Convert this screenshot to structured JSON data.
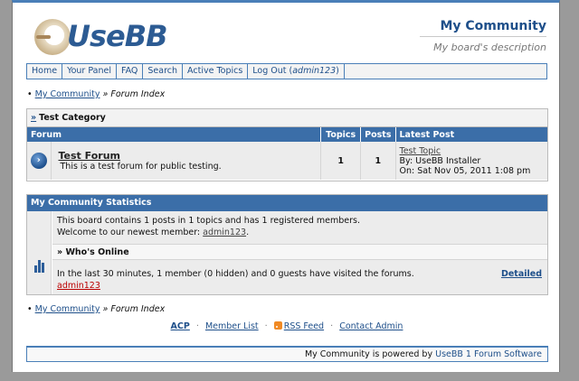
{
  "header": {
    "logo_text": "UseBB",
    "board_title": "My Community",
    "board_description": "My board's description"
  },
  "menu": {
    "items": [
      {
        "label": "Home"
      },
      {
        "label": "Your Panel"
      },
      {
        "label": "FAQ"
      },
      {
        "label": "Search"
      },
      {
        "label": "Active Topics"
      }
    ],
    "logout_label": "Log Out (",
    "logout_user": "admin123",
    "logout_close": ")"
  },
  "breadcrumb": {
    "bullet": "•",
    "home": "My Community",
    "separator": "»",
    "current": "Forum Index"
  },
  "category": {
    "arrow": "»",
    "name": "Test Category",
    "columns": {
      "forum": "Forum",
      "topics": "Topics",
      "posts": "Posts",
      "last_post": "Latest Post"
    },
    "forums": [
      {
        "name": "Test Forum",
        "description": "This is a test forum for public testing.",
        "topics": "1",
        "posts": "1",
        "last_topic": "Test Topic",
        "last_by": "By: UseBB Installer",
        "last_on": "On: Sat Nov 05, 2011 1:08 pm"
      }
    ]
  },
  "stats": {
    "title": "My Community Statistics",
    "line1": "This board contains 1 posts in 1 topics and has 1 registered members.",
    "line2_prefix": "Welcome to our newest member: ",
    "newest_member": "admin123",
    "line2_suffix": ".",
    "online_heading": "» Who's Online",
    "online_text": "In the last 30 minutes, 1 member (0 hidden) and 0 guests have visited the forums.",
    "online_user": "admin123",
    "detailed_label": "Detailed"
  },
  "footer": {
    "links": {
      "acp": "ACP",
      "members": "Member List",
      "rss": "RSS Feed",
      "contact": "Contact Admin"
    },
    "separator": "·",
    "powered_prefix": "My Community is powered by ",
    "powered_link": "UseBB 1 Forum Software"
  },
  "colors": {
    "accent": "#3b6ea8",
    "link": "#1e4f8a",
    "online_user": "#bb0000"
  },
  "icons": [
    "forum-status-icon",
    "statistics-bar-icon",
    "rss-icon"
  ]
}
